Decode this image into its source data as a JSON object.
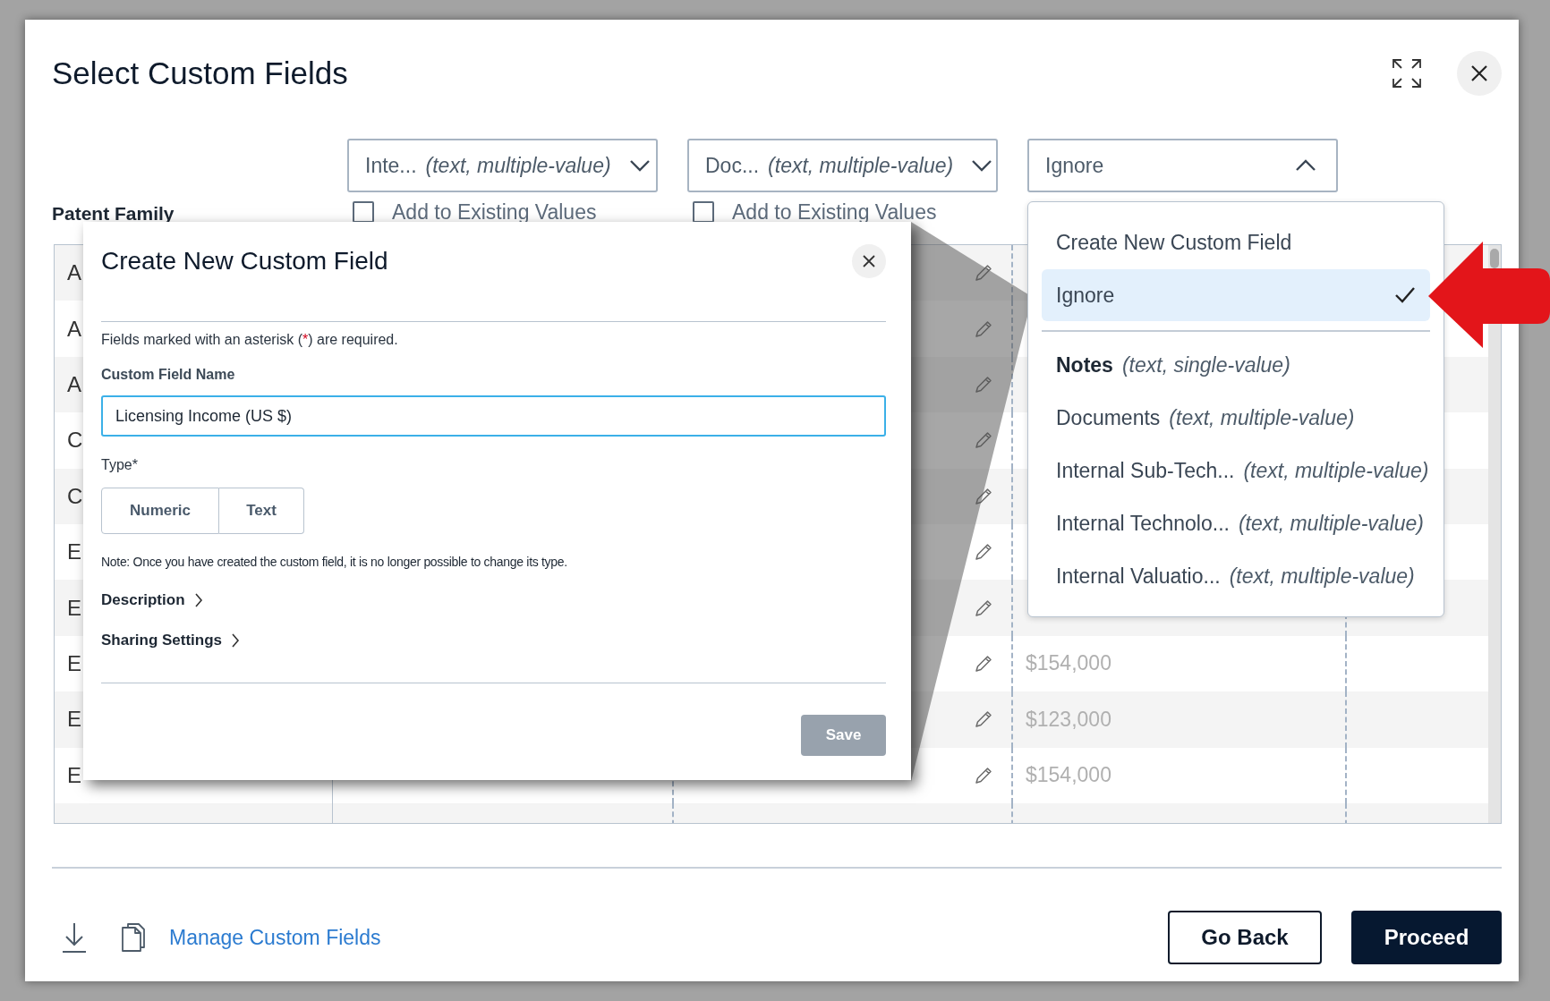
{
  "dialog": {
    "title": "Select Custom Fields"
  },
  "column_label": "Patent Family",
  "column_selectors": [
    {
      "value": "Inte...",
      "type_hint": "(text, multiple-value)",
      "open": false,
      "add_to_existing": {
        "label": "Add to Existing Values",
        "checked": false
      }
    },
    {
      "value": "Doc...",
      "type_hint": "(text, multiple-value)",
      "open": false,
      "add_to_existing": {
        "label": "Add to Existing Values",
        "checked": false
      }
    },
    {
      "value": "Ignore",
      "open": true
    }
  ],
  "table": {
    "rows": [
      {
        "column_1": "A"
      },
      {
        "column_1": "A"
      },
      {
        "column_1": "A"
      },
      {
        "column_1": "C"
      },
      {
        "column_1": "C"
      },
      {
        "column_1": "E"
      },
      {
        "column_1": "E"
      },
      {
        "column_1": "E",
        "column_4": "$154,000"
      },
      {
        "column_1": "E",
        "column_4": "$123,000"
      },
      {
        "column_1": "E",
        "column_4": "$154,000"
      }
    ]
  },
  "dropdown_menu": {
    "items": [
      {
        "kind": "action",
        "label": "Create New Custom Field",
        "selected": false
      },
      {
        "kind": "action",
        "label": "Ignore",
        "selected": true
      },
      {
        "kind": "field",
        "label": "Notes",
        "type_hint": "(text, single-value)",
        "selected": false,
        "emphasized": true
      },
      {
        "kind": "field",
        "label": "Documents",
        "type_hint": "(text, multiple-value)",
        "selected": false,
        "emphasized": false
      },
      {
        "kind": "field",
        "label": "Internal Sub-Tech...",
        "type_hint": "(text, multiple-value)",
        "selected": false,
        "emphasized": false
      },
      {
        "kind": "field",
        "label": "Internal Technolo...",
        "type_hint": "(text, multiple-value)",
        "selected": false,
        "emphasized": false
      },
      {
        "kind": "field",
        "label": "Internal Valuatio...",
        "type_hint": "(text, multiple-value)",
        "selected": false,
        "emphasized": false
      }
    ]
  },
  "create_field_popup": {
    "title": "Create New Custom Field",
    "required_note": {
      "text_before": "Fields marked with an asterisk (",
      "mark": "*",
      "text_after": ") are required."
    },
    "name_label": "Custom Field Name",
    "name_value": "Licensing Income (US $)",
    "type_label": "Type*",
    "type_options": [
      {
        "label": "Numeric",
        "selected": false
      },
      {
        "label": "Text",
        "selected": false
      }
    ],
    "type_note": "Note: Once you have created the custom field, it is no longer possible to change its type.",
    "sections": [
      {
        "label": "Description",
        "expanded": false
      },
      {
        "label": "Sharing Settings",
        "expanded": false
      }
    ],
    "save_button": {
      "label": "Save",
      "disabled": true
    }
  },
  "footer": {
    "link": "Manage Custom Fields",
    "buttons": [
      {
        "label": "Go Back",
        "kind": "secondary"
      },
      {
        "label": "Proceed",
        "kind": "primary"
      }
    ]
  }
}
